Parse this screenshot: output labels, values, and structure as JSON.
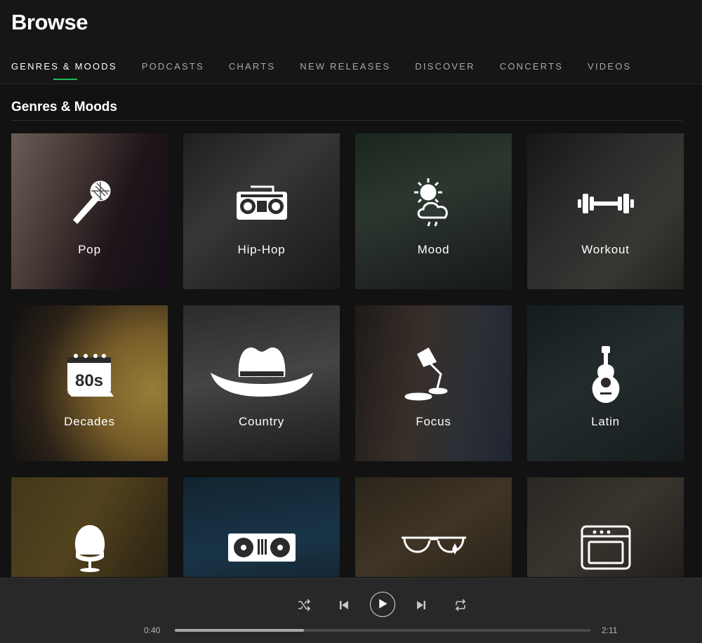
{
  "header": {
    "title": "Browse",
    "tabs": [
      {
        "label": "GENRES & MOODS",
        "active": true
      },
      {
        "label": "PODCASTS"
      },
      {
        "label": "CHARTS"
      },
      {
        "label": "NEW RELEASES"
      },
      {
        "label": "DISCOVER"
      },
      {
        "label": "CONCERTS"
      },
      {
        "label": "VIDEOS"
      }
    ],
    "accent_color": "#1db954"
  },
  "section": {
    "title": "Genres & Moods"
  },
  "tiles": [
    {
      "label": "Pop",
      "icon": "microphone-icon"
    },
    {
      "label": "Hip-Hop",
      "icon": "boombox-icon"
    },
    {
      "label": "Mood",
      "icon": "weather-icon"
    },
    {
      "label": "Workout",
      "icon": "dumbbell-icon"
    },
    {
      "label": "Decades",
      "icon": "calendar-80s-icon",
      "icon_text": "80s"
    },
    {
      "label": "Country",
      "icon": "cowboy-hat-icon"
    },
    {
      "label": "Focus",
      "icon": "desk-lamp-icon"
    },
    {
      "label": "Latin",
      "icon": "guitar-icon"
    },
    {
      "label": "",
      "icon": "egg-chair-icon"
    },
    {
      "label": "",
      "icon": "turntables-icon"
    },
    {
      "label": "",
      "icon": "sunglasses-icon"
    },
    {
      "label": "",
      "icon": "amplifier-icon"
    }
  ],
  "player": {
    "elapsed": "0:40",
    "duration": "2:11",
    "progress": 0.31
  }
}
